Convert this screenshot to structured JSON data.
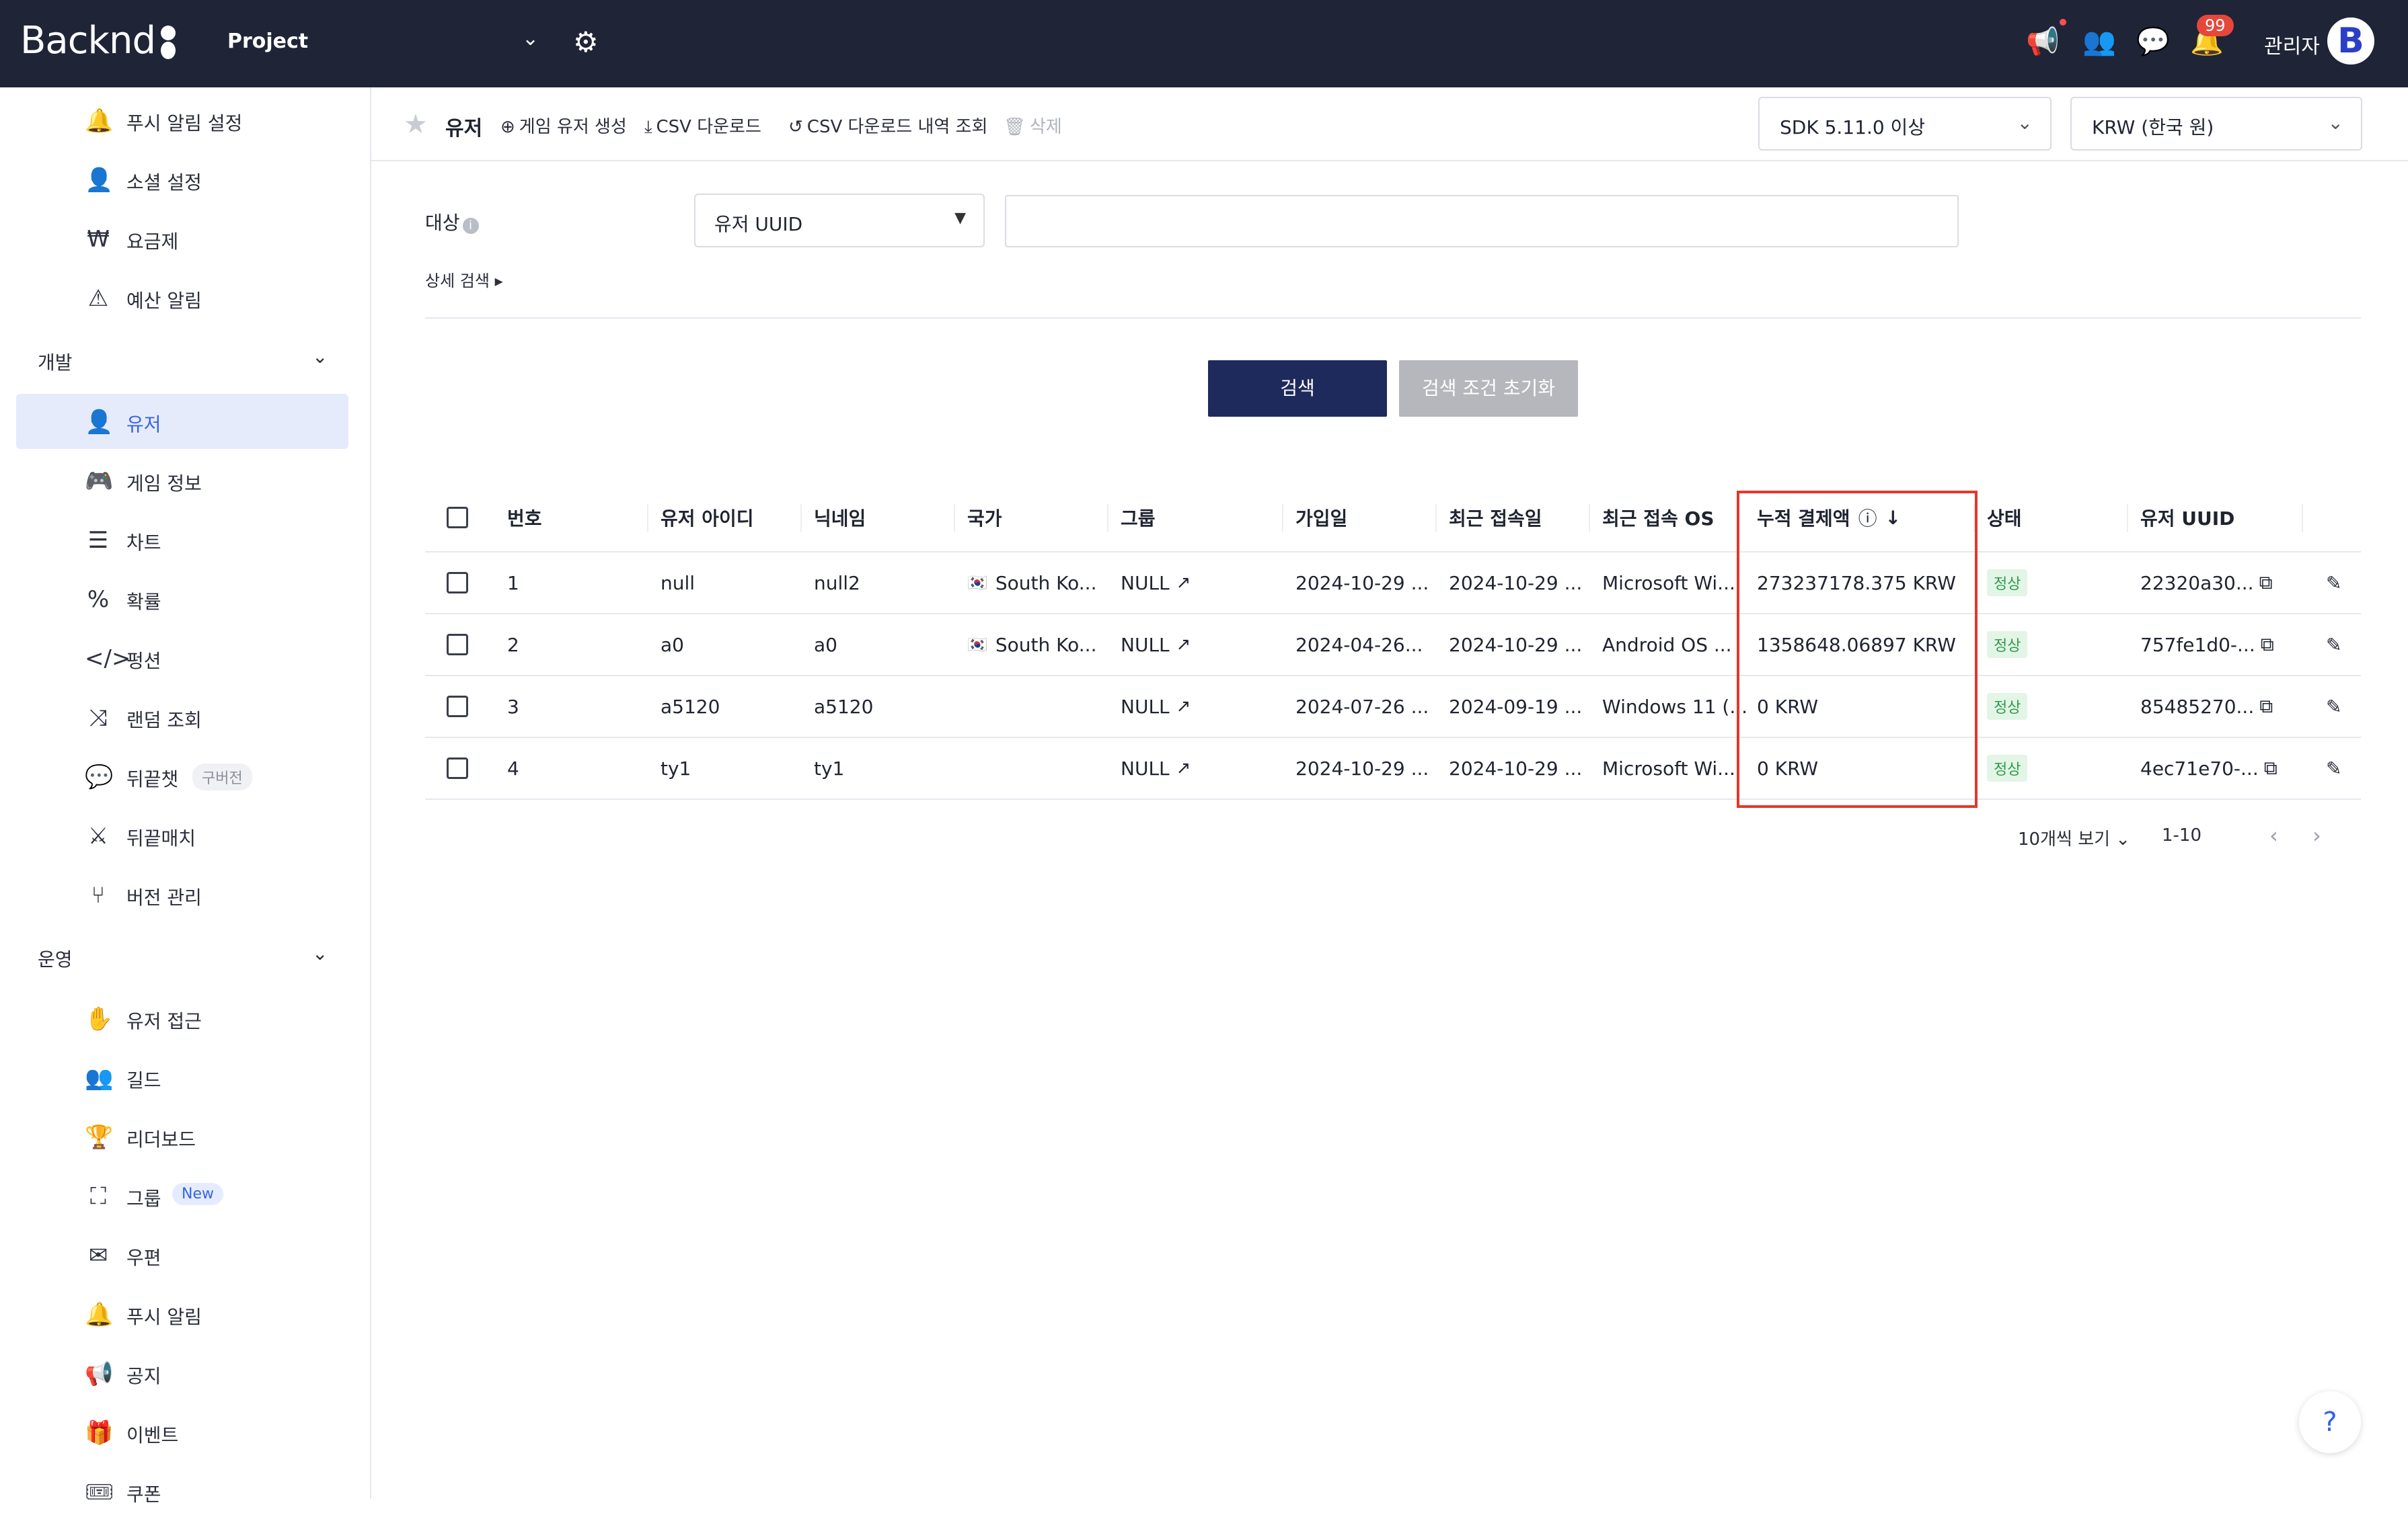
{
  "topbar": {
    "logo": "Backnd",
    "project": "Project",
    "admin": "관리자",
    "notification_count": "99",
    "avatar_letter": "B"
  },
  "sidebar": {
    "items_top": [
      {
        "label": "푸시 알림 설정",
        "icon": "bell-gear-icon"
      },
      {
        "label": "소셜 설정",
        "icon": "user-gear-icon"
      },
      {
        "label": "요금제",
        "icon": "won-icon"
      },
      {
        "label": "예산 알림",
        "icon": "warning-icon"
      }
    ],
    "section_dev": "개발",
    "items_dev": [
      {
        "label": "유저",
        "icon": "user-icon"
      },
      {
        "label": "게임 정보",
        "icon": "gamepad-icon"
      },
      {
        "label": "차트",
        "icon": "chart-icon"
      },
      {
        "label": "확률",
        "icon": "percent-icon"
      },
      {
        "label": "펑션",
        "icon": "code-icon"
      },
      {
        "label": "랜덤 조회",
        "icon": "shuffle-icon"
      },
      {
        "label": "뒤끝챗",
        "icon": "chat-icon",
        "tag": "구버전"
      },
      {
        "label": "뒤끝매치",
        "icon": "swords-icon"
      },
      {
        "label": "버전 관리",
        "icon": "branch-icon"
      }
    ],
    "section_ops": "운영",
    "items_ops": [
      {
        "label": "유저 접근",
        "icon": "hand-icon"
      },
      {
        "label": "길드",
        "icon": "users-icon"
      },
      {
        "label": "리더보드",
        "icon": "trophy-icon"
      },
      {
        "label": "그룹",
        "icon": "group-icon",
        "tag": "New"
      },
      {
        "label": "우편",
        "icon": "mail-icon"
      },
      {
        "label": "푸시 알림",
        "icon": "bell-icon"
      },
      {
        "label": "공지",
        "icon": "megaphone-icon"
      },
      {
        "label": "이벤트",
        "icon": "gift-icon"
      },
      {
        "label": "쿠폰",
        "icon": "coupon-icon"
      }
    ]
  },
  "toolbar": {
    "title": "유저",
    "create_user": "게임 유저 생성",
    "csv_download": "CSV 다운로드",
    "csv_history": "CSV 다운로드 내역 조회",
    "delete": "삭제",
    "sdk_select": "SDK 5.11.0 이상",
    "currency_select": "KRW (한국 원)"
  },
  "search": {
    "target_label": "대상",
    "target_select": "유저 UUID",
    "input_placeholder": "",
    "detail_search": "상세 검색",
    "search_button": "검색",
    "reset_button": "검색 조건 초기화"
  },
  "table": {
    "headers": [
      "번호",
      "유저 아이디",
      "닉네임",
      "국가",
      "그룹",
      "가입일",
      "최근 접속일",
      "최근 접속 OS",
      "누적 결제액",
      "상태",
      "유저 UUID"
    ],
    "rows": [
      {
        "no": "1",
        "id": "null",
        "nickname": "null2",
        "country": "South Ko...",
        "group": "NULL",
        "joined": "2024-10-29 ...",
        "last": "2024-10-29 ...",
        "os": "Microsoft Wi...",
        "paid": "273237178.375 KRW",
        "status": "정상",
        "uuid": "22320a30..."
      },
      {
        "no": "2",
        "id": "a0",
        "nickname": "a0",
        "country": "South Ko...",
        "group": "NULL",
        "joined": "2024-04-26...",
        "last": "2024-10-29 ...",
        "os": "Android OS ...",
        "paid": "1358648.06897 KRW",
        "status": "정상",
        "uuid": "757fe1d0-..."
      },
      {
        "no": "3",
        "id": "a5120",
        "nickname": "a5120",
        "country": "",
        "group": "NULL",
        "joined": "2024-07-26 ...",
        "last": "2024-09-19 ...",
        "os": "Windows 11 (...",
        "paid": "0 KRW",
        "status": "정상",
        "uuid": "85485270..."
      },
      {
        "no": "4",
        "id": "ty1",
        "nickname": "ty1",
        "country": "",
        "group": "NULL",
        "joined": "2024-10-29 ...",
        "last": "2024-10-29 ...",
        "os": "Microsoft Wi...",
        "paid": "0 KRW",
        "status": "정상",
        "uuid": "4ec71e70-..."
      }
    ]
  },
  "pagination": {
    "page_size": "10개씩 보기",
    "range": "1-10"
  },
  "help": "?"
}
